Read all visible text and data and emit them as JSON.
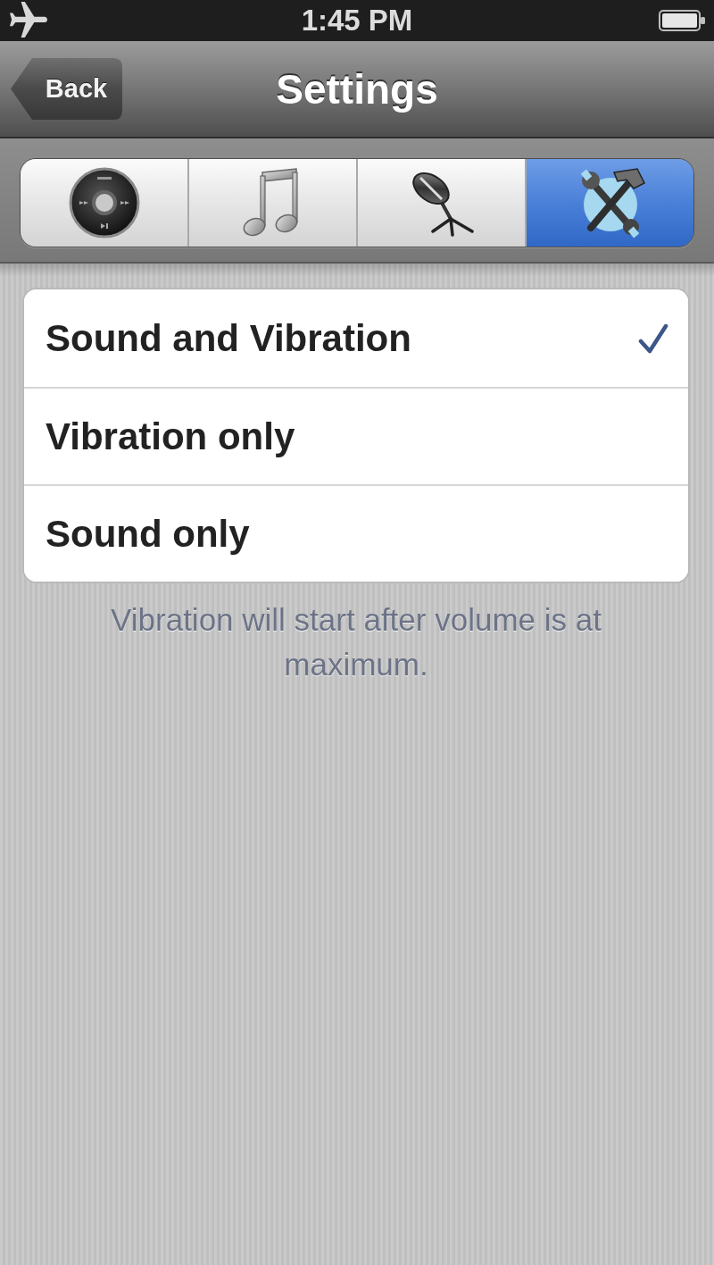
{
  "status_bar": {
    "time": "1:45 PM"
  },
  "nav_bar": {
    "back": "Back",
    "title": "Settings"
  },
  "segments": [
    {
      "kind": "player",
      "selected": false
    },
    {
      "kind": "music",
      "selected": false
    },
    {
      "kind": "microphone",
      "selected": false
    },
    {
      "kind": "tools",
      "selected": true
    }
  ],
  "options": [
    {
      "label": "Sound and Vibration",
      "checked": true
    },
    {
      "label": "Vibration only",
      "checked": false
    },
    {
      "label": "Sound only",
      "checked": false
    }
  ],
  "footer": "Vibration will start after volume is at maximum."
}
